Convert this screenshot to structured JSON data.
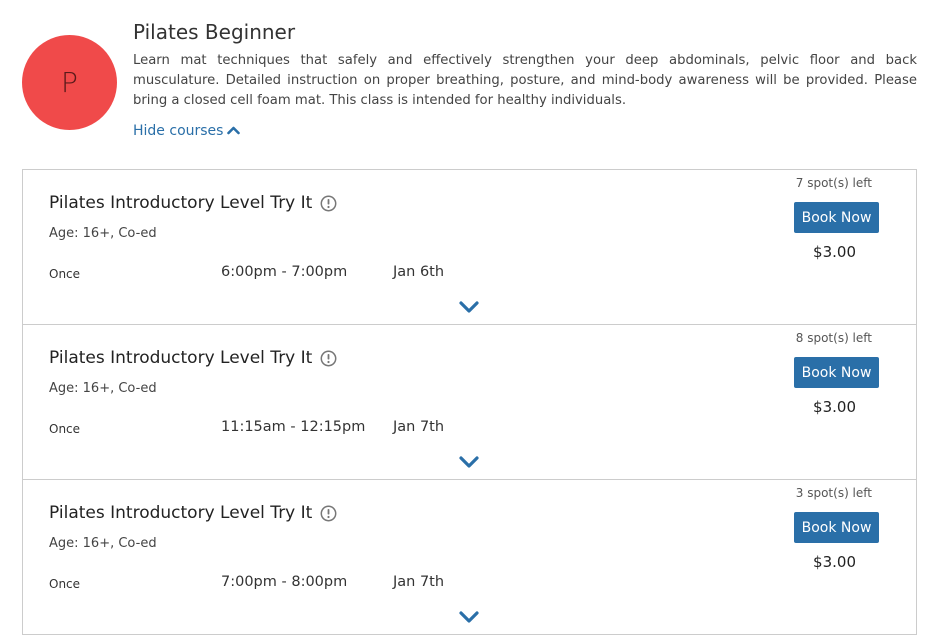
{
  "program": {
    "avatar_letter": "P",
    "title": "Pilates Beginner",
    "description": "Learn mat techniques that safely and effectively strengthen your deep abdominals, pelvic floor and back musculature. Detailed instruction on proper breathing, posture, and mind-body awareness will be provided. Please bring a closed cell foam mat. This class is intended for healthy individuals.",
    "hide_courses_label": "Hide courses",
    "accent_color": "#2a6fa8",
    "avatar_color": "#f04a4a"
  },
  "courses": [
    {
      "name": "Pilates Introductory Level Try It",
      "meta": "Age: 16+, Co-ed",
      "frequency": "Once",
      "time": "6:00pm - 7:00pm",
      "date": "Jan 6th",
      "spots": "7 spot(s) left",
      "button_label": "Book Now",
      "price": "$3.00"
    },
    {
      "name": "Pilates Introductory Level Try It",
      "meta": "Age: 16+, Co-ed",
      "frequency": "Once",
      "time": "11:15am - 12:15pm",
      "date": "Jan 7th",
      "spots": "8 spot(s) left",
      "button_label": "Book Now",
      "price": "$3.00"
    },
    {
      "name": "Pilates Introductory Level Try It",
      "meta": "Age: 16+, Co-ed",
      "frequency": "Once",
      "time": "7:00pm - 8:00pm",
      "date": "Jan 7th",
      "spots": "3 spot(s) left",
      "button_label": "Book Now",
      "price": "$3.00"
    }
  ]
}
